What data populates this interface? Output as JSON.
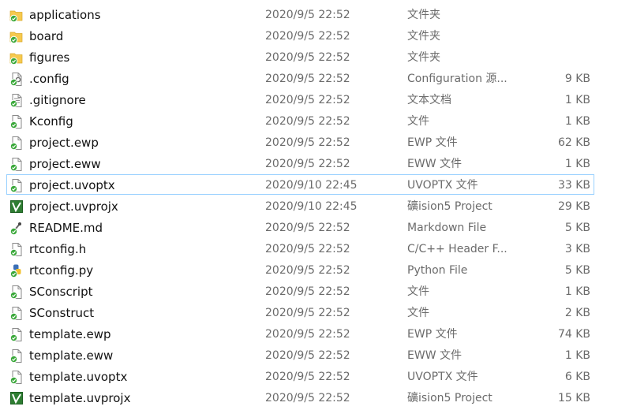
{
  "files": [
    {
      "name": "applications",
      "date": "2020/9/5 22:52",
      "type": "文件夹",
      "size": "",
      "icon": "folder-icon"
    },
    {
      "name": "board",
      "date": "2020/9/5 22:52",
      "type": "文件夹",
      "size": "",
      "icon": "folder-icon"
    },
    {
      "name": "figures",
      "date": "2020/9/5 22:52",
      "type": "文件夹",
      "size": "",
      "icon": "folder-icon"
    },
    {
      "name": ".config",
      "date": "2020/9/5 22:52",
      "type": "Configuration 源...",
      "size": "9 KB",
      "icon": "config-file-icon"
    },
    {
      "name": ".gitignore",
      "date": "2020/9/5 22:52",
      "type": "文本文档",
      "size": "1 KB",
      "icon": "text-file-icon"
    },
    {
      "name": "Kconfig",
      "date": "2020/9/5 22:52",
      "type": "文件",
      "size": "1 KB",
      "icon": "file-icon"
    },
    {
      "name": "project.ewp",
      "date": "2020/9/5 22:52",
      "type": "EWP 文件",
      "size": "62 KB",
      "icon": "file-icon"
    },
    {
      "name": "project.eww",
      "date": "2020/9/5 22:52",
      "type": "EWW 文件",
      "size": "1 KB",
      "icon": "file-icon"
    },
    {
      "name": "project.uvoptx",
      "date": "2020/9/10 22:45",
      "type": "UVOPTX 文件",
      "size": "33 KB",
      "icon": "file-icon"
    },
    {
      "name": "project.uvprojx",
      "date": "2020/9/10 22:45",
      "type": "礦ision5 Project",
      "size": "29 KB",
      "icon": "keil-project-icon"
    },
    {
      "name": "README.md",
      "date": "2020/9/5 22:52",
      "type": "Markdown File",
      "size": "5 KB",
      "icon": "markdown-file-icon"
    },
    {
      "name": "rtconfig.h",
      "date": "2020/9/5 22:52",
      "type": "C/C++ Header F...",
      "size": "3 KB",
      "icon": "file-icon"
    },
    {
      "name": "rtconfig.py",
      "date": "2020/9/5 22:52",
      "type": "Python File",
      "size": "5 KB",
      "icon": "python-file-icon"
    },
    {
      "name": "SConscript",
      "date": "2020/9/5 22:52",
      "type": "文件",
      "size": "1 KB",
      "icon": "file-icon"
    },
    {
      "name": "SConstruct",
      "date": "2020/9/5 22:52",
      "type": "文件",
      "size": "2 KB",
      "icon": "file-icon"
    },
    {
      "name": "template.ewp",
      "date": "2020/9/5 22:52",
      "type": "EWP 文件",
      "size": "74 KB",
      "icon": "file-icon"
    },
    {
      "name": "template.eww",
      "date": "2020/9/5 22:52",
      "type": "EWW 文件",
      "size": "1 KB",
      "icon": "file-icon"
    },
    {
      "name": "template.uvoptx",
      "date": "2020/9/5 22:52",
      "type": "UVOPTX 文件",
      "size": "6 KB",
      "icon": "file-icon"
    },
    {
      "name": "template.uvprojx",
      "date": "2020/9/5 22:52",
      "type": "礦ision5 Project",
      "size": "15 KB",
      "icon": "keil-project-icon"
    }
  ],
  "focused_index": 8,
  "colors": {
    "folder": "#f6c94e",
    "sync_badge": "#3aa83a",
    "focus_border": "#99d1ff",
    "keil": "#2e7d32"
  }
}
